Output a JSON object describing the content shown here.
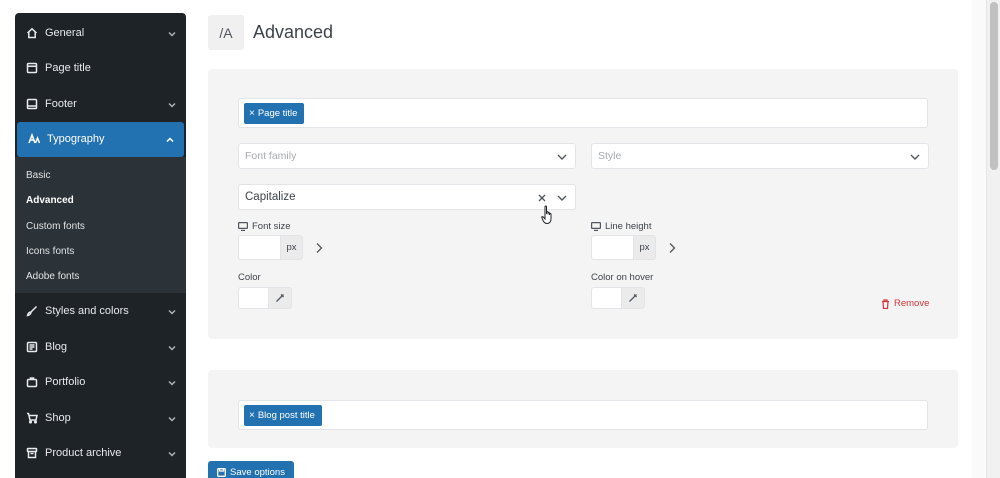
{
  "sidebar": {
    "items": [
      {
        "label": "General",
        "icon": "home-icon",
        "chevron": true
      },
      {
        "label": "Page title",
        "icon": "page-icon",
        "chevron": false
      },
      {
        "label": "Footer",
        "icon": "footer-icon",
        "chevron": true
      },
      {
        "label": "Typography",
        "icon": "typography-icon",
        "chevron": true,
        "active": true
      },
      {
        "label": "Styles and colors",
        "icon": "brush-icon",
        "chevron": true
      },
      {
        "label": "Blog",
        "icon": "blog-icon",
        "chevron": true
      },
      {
        "label": "Portfolio",
        "icon": "portfolio-icon",
        "chevron": true
      },
      {
        "label": "Shop",
        "icon": "cart-icon",
        "chevron": true
      },
      {
        "label": "Product archive",
        "icon": "archive-icon",
        "chevron": true
      }
    ],
    "submenu": [
      "Basic",
      "Advanced",
      "Custom fonts",
      "Icons fonts",
      "Adobe fonts"
    ],
    "current_sub": "Advanced"
  },
  "header": {
    "icon_text": "/A",
    "title": "Advanced"
  },
  "rule1": {
    "tag": "Page title",
    "font_family_placeholder": "Font family",
    "style_placeholder": "Style",
    "transform_value": "Capitalize",
    "font_size_label": "Font size",
    "font_size_unit": "px",
    "line_height_label": "Line height",
    "line_height_unit": "px",
    "color_label": "Color",
    "color_hover_label": "Color on hover",
    "remove_label": "Remove"
  },
  "rule2": {
    "tag": "Blog post title"
  },
  "save_label": "Save options",
  "colors": {
    "accent": "#2271b1",
    "sidebar": "#1d2327",
    "danger": "#d63638"
  }
}
